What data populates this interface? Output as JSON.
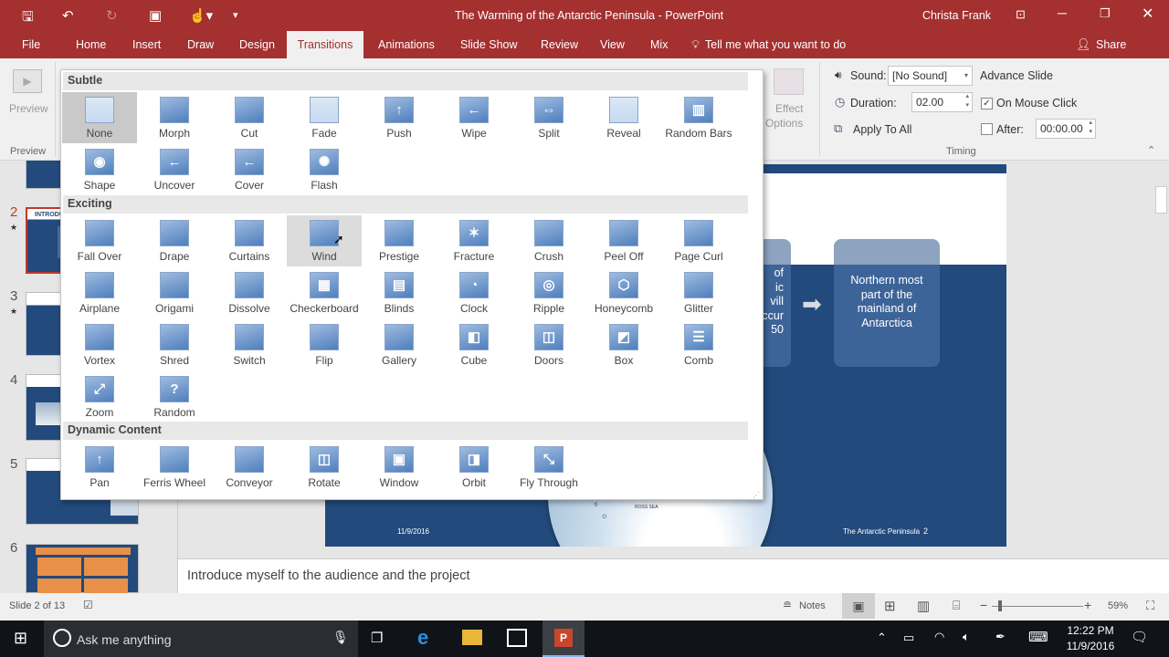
{
  "titlebar": {
    "title": "The Warming of the Antarctic Peninsula  -  PowerPoint",
    "user": "Christa Frank",
    "accent": "#a4302f"
  },
  "tabs": [
    "File",
    "Home",
    "Insert",
    "Draw",
    "Design",
    "Transitions",
    "Animations",
    "Slide Show",
    "Review",
    "View",
    "Mix"
  ],
  "active_tab": "Transitions",
  "tell_me": "Tell me what you want to do",
  "share": "Share",
  "ribbon": {
    "preview_button": "Preview",
    "preview_group": "Preview",
    "effect_options": [
      "Effect",
      "Options"
    ],
    "sound_label": "Sound:",
    "sound_value": "[No Sound]",
    "duration_label": "Duration:",
    "duration_value": "02.00",
    "apply_all": "Apply To All",
    "advance_slide": "Advance Slide",
    "on_mouse_click": "On Mouse Click",
    "on_mouse_click_checked": true,
    "after_label": "After:",
    "after_value": "00:00.00",
    "after_checked": false,
    "timing_group": "Timing"
  },
  "gallery": {
    "sections": [
      {
        "title": "Subtle",
        "items": [
          {
            "label": "None",
            "icon": "none",
            "selected": true
          },
          {
            "label": "Morph",
            "icon": "morph"
          },
          {
            "label": "Cut",
            "icon": "cut"
          },
          {
            "label": "Fade",
            "icon": "fade"
          },
          {
            "label": "Push",
            "icon": "push"
          },
          {
            "label": "Wipe",
            "icon": "wipe"
          },
          {
            "label": "Split",
            "icon": "split"
          },
          {
            "label": "Reveal",
            "icon": "reveal"
          },
          {
            "label": "Random Bars",
            "icon": "random-bars"
          },
          {
            "label": "Shape",
            "icon": "shape"
          },
          {
            "label": "Uncover",
            "icon": "uncover"
          },
          {
            "label": "Cover",
            "icon": "cover"
          },
          {
            "label": "Flash",
            "icon": "flash"
          }
        ]
      },
      {
        "title": "Exciting",
        "items": [
          {
            "label": "Fall Over",
            "icon": "fall-over"
          },
          {
            "label": "Drape",
            "icon": "drape"
          },
          {
            "label": "Curtains",
            "icon": "curtains"
          },
          {
            "label": "Wind",
            "icon": "wind",
            "hover": true
          },
          {
            "label": "Prestige",
            "icon": "prestige"
          },
          {
            "label": "Fracture",
            "icon": "fracture"
          },
          {
            "label": "Crush",
            "icon": "crush"
          },
          {
            "label": "Peel Off",
            "icon": "peel-off"
          },
          {
            "label": "Page Curl",
            "icon": "page-curl"
          },
          {
            "label": "Airplane",
            "icon": "airplane"
          },
          {
            "label": "Origami",
            "icon": "origami"
          },
          {
            "label": "Dissolve",
            "icon": "dissolve"
          },
          {
            "label": "Checkerboard",
            "icon": "checkerboard"
          },
          {
            "label": "Blinds",
            "icon": "blinds"
          },
          {
            "label": "Clock",
            "icon": "clock"
          },
          {
            "label": "Ripple",
            "icon": "ripple"
          },
          {
            "label": "Honeycomb",
            "icon": "honeycomb"
          },
          {
            "label": "Glitter",
            "icon": "glitter"
          },
          {
            "label": "Vortex",
            "icon": "vortex"
          },
          {
            "label": "Shred",
            "icon": "shred"
          },
          {
            "label": "Switch",
            "icon": "switch"
          },
          {
            "label": "Flip",
            "icon": "flip"
          },
          {
            "label": "Gallery",
            "icon": "gallery"
          },
          {
            "label": "Cube",
            "icon": "cube"
          },
          {
            "label": "Doors",
            "icon": "doors"
          },
          {
            "label": "Box",
            "icon": "box"
          },
          {
            "label": "Comb",
            "icon": "comb"
          },
          {
            "label": "Zoom",
            "icon": "zoom"
          },
          {
            "label": "Random",
            "icon": "random"
          }
        ]
      },
      {
        "title": "Dynamic Content",
        "items": [
          {
            "label": "Pan",
            "icon": "pan"
          },
          {
            "label": "Ferris Wheel",
            "icon": "ferris-wheel"
          },
          {
            "label": "Conveyor",
            "icon": "conveyor"
          },
          {
            "label": "Rotate",
            "icon": "rotate"
          },
          {
            "label": "Window",
            "icon": "window"
          },
          {
            "label": "Orbit",
            "icon": "orbit"
          },
          {
            "label": "Fly Through",
            "icon": "fly-through"
          }
        ]
      }
    ]
  },
  "thumbnails": [
    "2",
    "3",
    "4",
    "5",
    "6"
  ],
  "current_slide": "2",
  "slide": {
    "left_box_lines": [
      "of",
      "ic",
      "vill",
      "ccur",
      "50"
    ],
    "right_box": "Northern most part of the mainland of Antarctica",
    "date": "11/9/2016",
    "footer": "The Antarctic Peninsula",
    "number": "2",
    "map_labels": [
      "ROSS SEA",
      "E R N O"
    ],
    "color": "#234a7c"
  },
  "notes": "Introduce myself to the audience and the project",
  "status": {
    "slide_of": "Slide 2 of 13",
    "notes": "Notes",
    "zoom": "59%",
    "zoom_level": 59
  },
  "taskbar": {
    "search": "Ask me anything",
    "time": "12:22 PM",
    "date": "11/9/2016"
  }
}
